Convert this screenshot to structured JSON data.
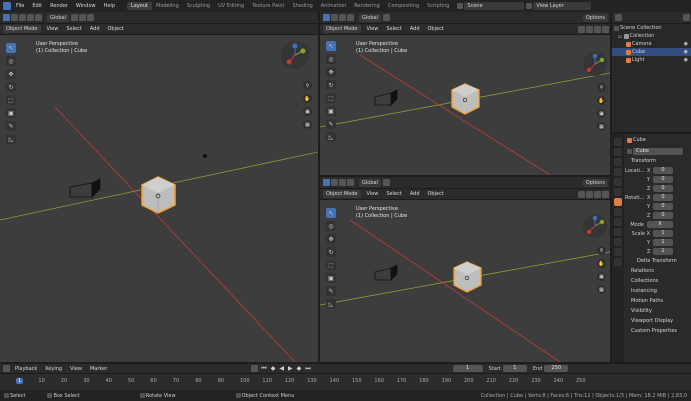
{
  "topbar": {
    "menus": [
      "File",
      "Edit",
      "Render",
      "Window",
      "Help"
    ],
    "workspaces": [
      "Layout",
      "Modeling",
      "Sculpting",
      "UV Editing",
      "Texture Paint",
      "Shading",
      "Animation",
      "Rendering",
      "Compositing",
      "Scripting"
    ],
    "scene": "Scene",
    "view_layer": "View Layer"
  },
  "viewport_header": {
    "orientation": "Global",
    "mode": "Object Mode",
    "menus": [
      "View",
      "Select",
      "Add",
      "Object"
    ],
    "options": "Options"
  },
  "viewports": {
    "main": {
      "perspective": "User Perspective",
      "collection": "(1) Collection | Cube"
    },
    "top_right": {
      "perspective": "User Perspective",
      "collection": "(1) Collection | Cube"
    },
    "bottom_right": {
      "perspective": "User Perspective",
      "collection": "(1) Collection | Cube"
    }
  },
  "outliner": {
    "root": "Scene Collection",
    "collection": "Collection",
    "items": [
      {
        "label": "Camera",
        "selected": false
      },
      {
        "label": "Cube",
        "selected": true
      },
      {
        "label": "Light",
        "selected": false
      }
    ]
  },
  "properties": {
    "object_name": "Cube",
    "field_name": "Cube",
    "transform_label": "Transform",
    "location_label": "Locati...",
    "rotation_label": "Rotati...",
    "mode_label": "Mode",
    "mode_value": "X",
    "scale_label": "Scale X",
    "axes": [
      "X",
      "Y",
      "Z"
    ],
    "location": [
      "0",
      "0",
      "0"
    ],
    "rotation": [
      "0",
      "0",
      "0"
    ],
    "scale": [
      "1",
      "1",
      "1"
    ],
    "delta_transform": "Delta Transform",
    "panels": [
      "Relations",
      "Collections",
      "Instancing",
      "Motion Paths",
      "Visibility",
      "Viewport Display",
      "Custom Properties"
    ]
  },
  "timeline": {
    "menus": [
      "Playback",
      "Keying",
      "View",
      "Marker"
    ],
    "current_frame": "1",
    "start_label": "Start",
    "start": "1",
    "end_label": "End",
    "end": "250",
    "ticks": [
      "1",
      "10",
      "20",
      "30",
      "40",
      "50",
      "60",
      "70",
      "80",
      "90",
      "100",
      "110",
      "120",
      "130",
      "140",
      "150",
      "160",
      "170",
      "180",
      "190",
      "200",
      "210",
      "220",
      "230",
      "240",
      "250"
    ]
  },
  "statusbar": {
    "select": "Select",
    "box_select": "Box Select",
    "rotate_view": "Rotate View",
    "context_menu": "Object Context Menu",
    "stats": "Collection | Cube | Verts:8 | Faces:6 | Tris:12 | Objects:1/3 | Mem: 18.2 MiB | 2.83.0"
  },
  "colors": {
    "accent": "#4772b3",
    "selection": "#f0a030",
    "x_axis": "#c23a3a",
    "y_axis": "#8aa232"
  }
}
